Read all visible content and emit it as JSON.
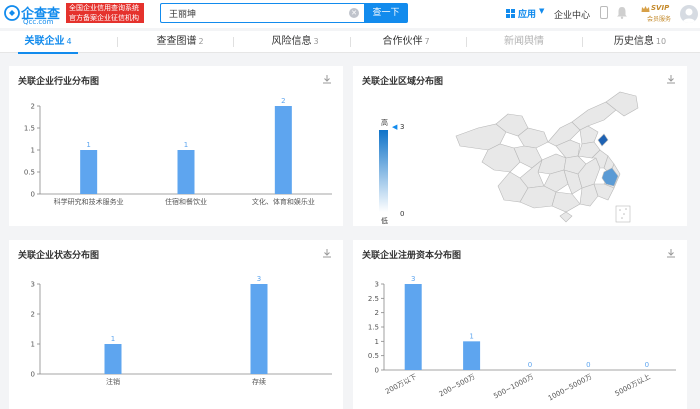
{
  "header": {
    "logo_text": "企查查",
    "logo_sub": "Qcc.com",
    "slogan_line1": "全国企业信用查询系统",
    "slogan_line2": "官方备案企业征信机构",
    "search_value": "王丽坤",
    "search_button": "查一下",
    "apps_label": "应用",
    "center_label": "企业中心",
    "svip_label": "SVIP",
    "svip_sub": "会员服务"
  },
  "tabs": [
    {
      "label": "关联企业",
      "count": "4",
      "active": true
    },
    {
      "label": "查查图谱",
      "count": "2"
    },
    {
      "label": "风险信息",
      "count": "3"
    },
    {
      "label": "合作伙伴",
      "count": "7"
    },
    {
      "label": "新闻舆情",
      "count": "",
      "disabled": true
    },
    {
      "label": "历史信息",
      "count": "10"
    }
  ],
  "panels": {
    "industry": {
      "title": "关联企业行业分布图"
    },
    "region": {
      "title": "关联企业区域分布图",
      "legend_high": "高",
      "legend_low": "低",
      "legend_max": "3",
      "legend_min": "0"
    },
    "status": {
      "title": "关联企业状态分布图"
    },
    "capital": {
      "title": "关联企业注册资本分布图"
    }
  },
  "colors": {
    "accent": "#128bed",
    "bar": "#5ea5ef",
    "map_fill": "#e8e8e8",
    "map_highlight": "#5b9bd5"
  },
  "chart_data": [
    {
      "type": "bar",
      "categories": [
        "科学研究和技术服务业",
        "住宿和餐饮业",
        "文化、体育和娱乐业"
      ],
      "values": [
        1,
        1,
        2
      ],
      "ylim": [
        0,
        2
      ],
      "yticks": [
        "0",
        "0.5",
        "1",
        "1.5",
        "2"
      ]
    },
    {
      "type": "bar",
      "categories": [
        "注销",
        "存续"
      ],
      "values": [
        1,
        3
      ],
      "ylim": [
        0,
        3
      ],
      "yticks": [
        "0",
        "1",
        "2",
        "3"
      ]
    },
    {
      "type": "bar",
      "categories": [
        "200万以下",
        "200~500万",
        "500~1000万",
        "1000~5000万",
        "5000万以上"
      ],
      "values": [
        3,
        1,
        0,
        0,
        0
      ],
      "ylim": [
        0,
        3
      ],
      "yticks": [
        "0",
        "0.5",
        "1",
        "1.5",
        "2",
        "2.5",
        "3"
      ]
    }
  ]
}
